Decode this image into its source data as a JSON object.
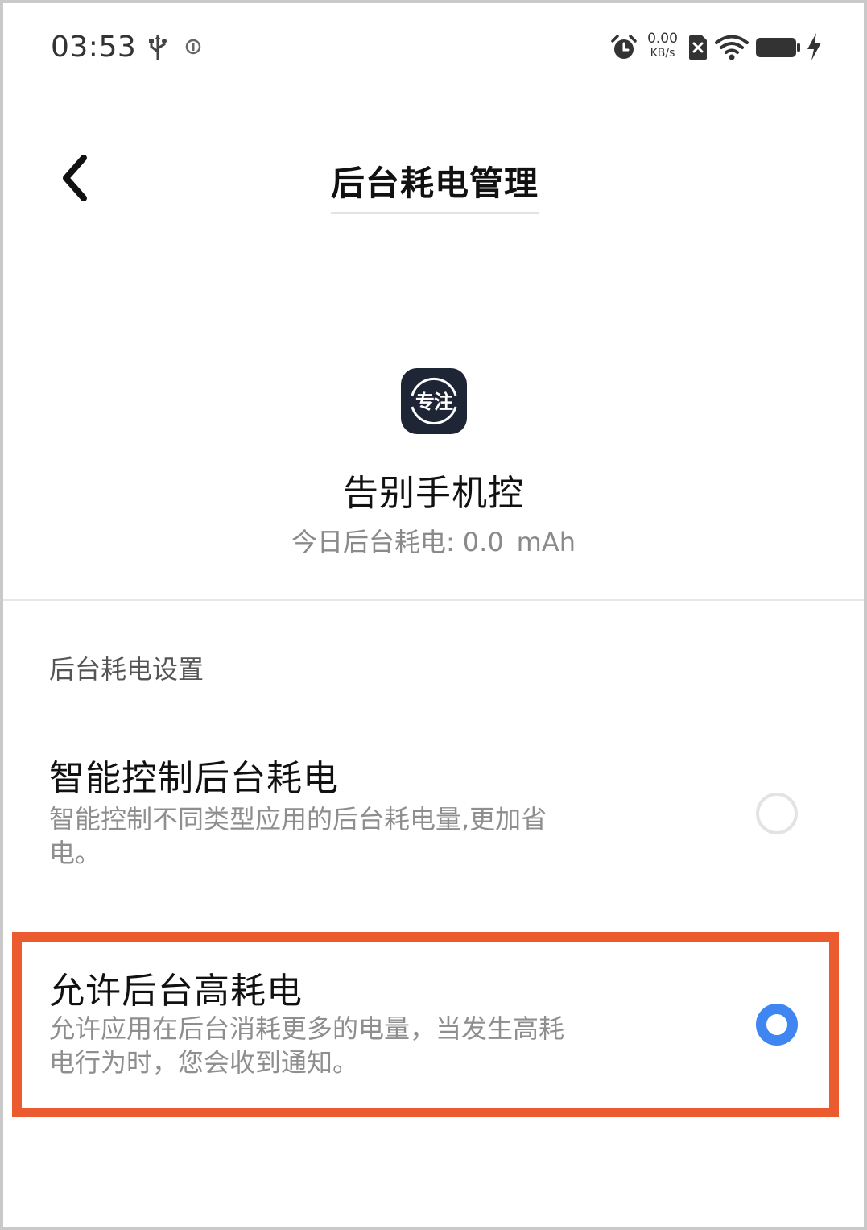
{
  "status_bar": {
    "time": "03:53",
    "net_speed_value": "0.00",
    "net_speed_unit": "KB/s",
    "icons": [
      "usb-icon",
      "info-icon",
      "alarm-icon",
      "sim-x-icon",
      "wifi-icon",
      "battery-icon",
      "charging-icon"
    ]
  },
  "header": {
    "title": "后台耗电管理",
    "back_icon": "chevron-left-icon"
  },
  "app": {
    "icon_text": "专注",
    "name": "告别手机控",
    "usage_label": "今日后台耗电:",
    "usage_value": "0.0",
    "usage_unit": "mAh"
  },
  "section": {
    "title": "后台耗电设置"
  },
  "options": [
    {
      "title": "智能控制后台耗电",
      "description_line1": "智能控制不同类型应用的后台耗电量,更加省",
      "description_line2": "电。",
      "selected": false
    },
    {
      "title": "允许后台高耗电",
      "description_line1": "允许应用在后台消耗更多的电量，当发生高耗",
      "description_line2": "电行为时，您会收到通知。",
      "selected": true
    }
  ],
  "colors": {
    "radio_selected": "#3f86f2",
    "highlight_border": "#ec5a2f",
    "app_icon_bg": "#1e2535"
  }
}
